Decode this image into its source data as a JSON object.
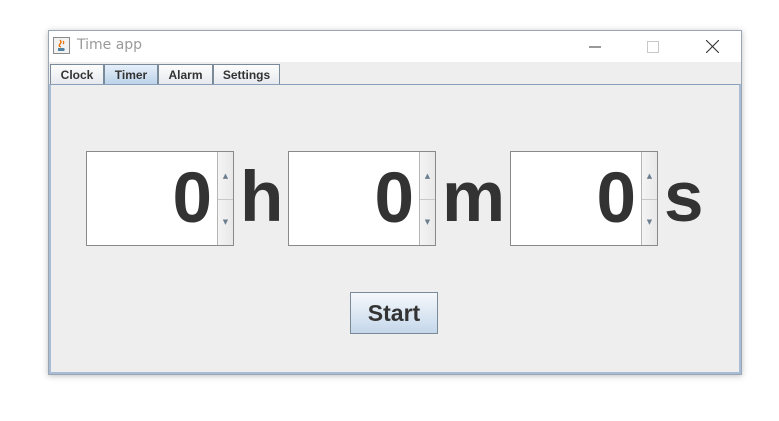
{
  "window": {
    "title": "Time app",
    "controls": {
      "minimize": "minimize-icon",
      "maximize": "maximize-icon",
      "close": "close-icon"
    }
  },
  "tabs": [
    {
      "label": "Clock",
      "active": false
    },
    {
      "label": "Timer",
      "active": true
    },
    {
      "label": "Alarm",
      "active": false
    },
    {
      "label": "Settings",
      "active": false
    }
  ],
  "timer": {
    "hours": {
      "value": "0",
      "unit": "h"
    },
    "minutes": {
      "value": "0",
      "unit": "m"
    },
    "seconds": {
      "value": "0",
      "unit": "s"
    },
    "start_label": "Start"
  },
  "colors": {
    "active_tab": "#bcd3ea",
    "panel_bg": "#eeeeee",
    "text": "#333333"
  }
}
